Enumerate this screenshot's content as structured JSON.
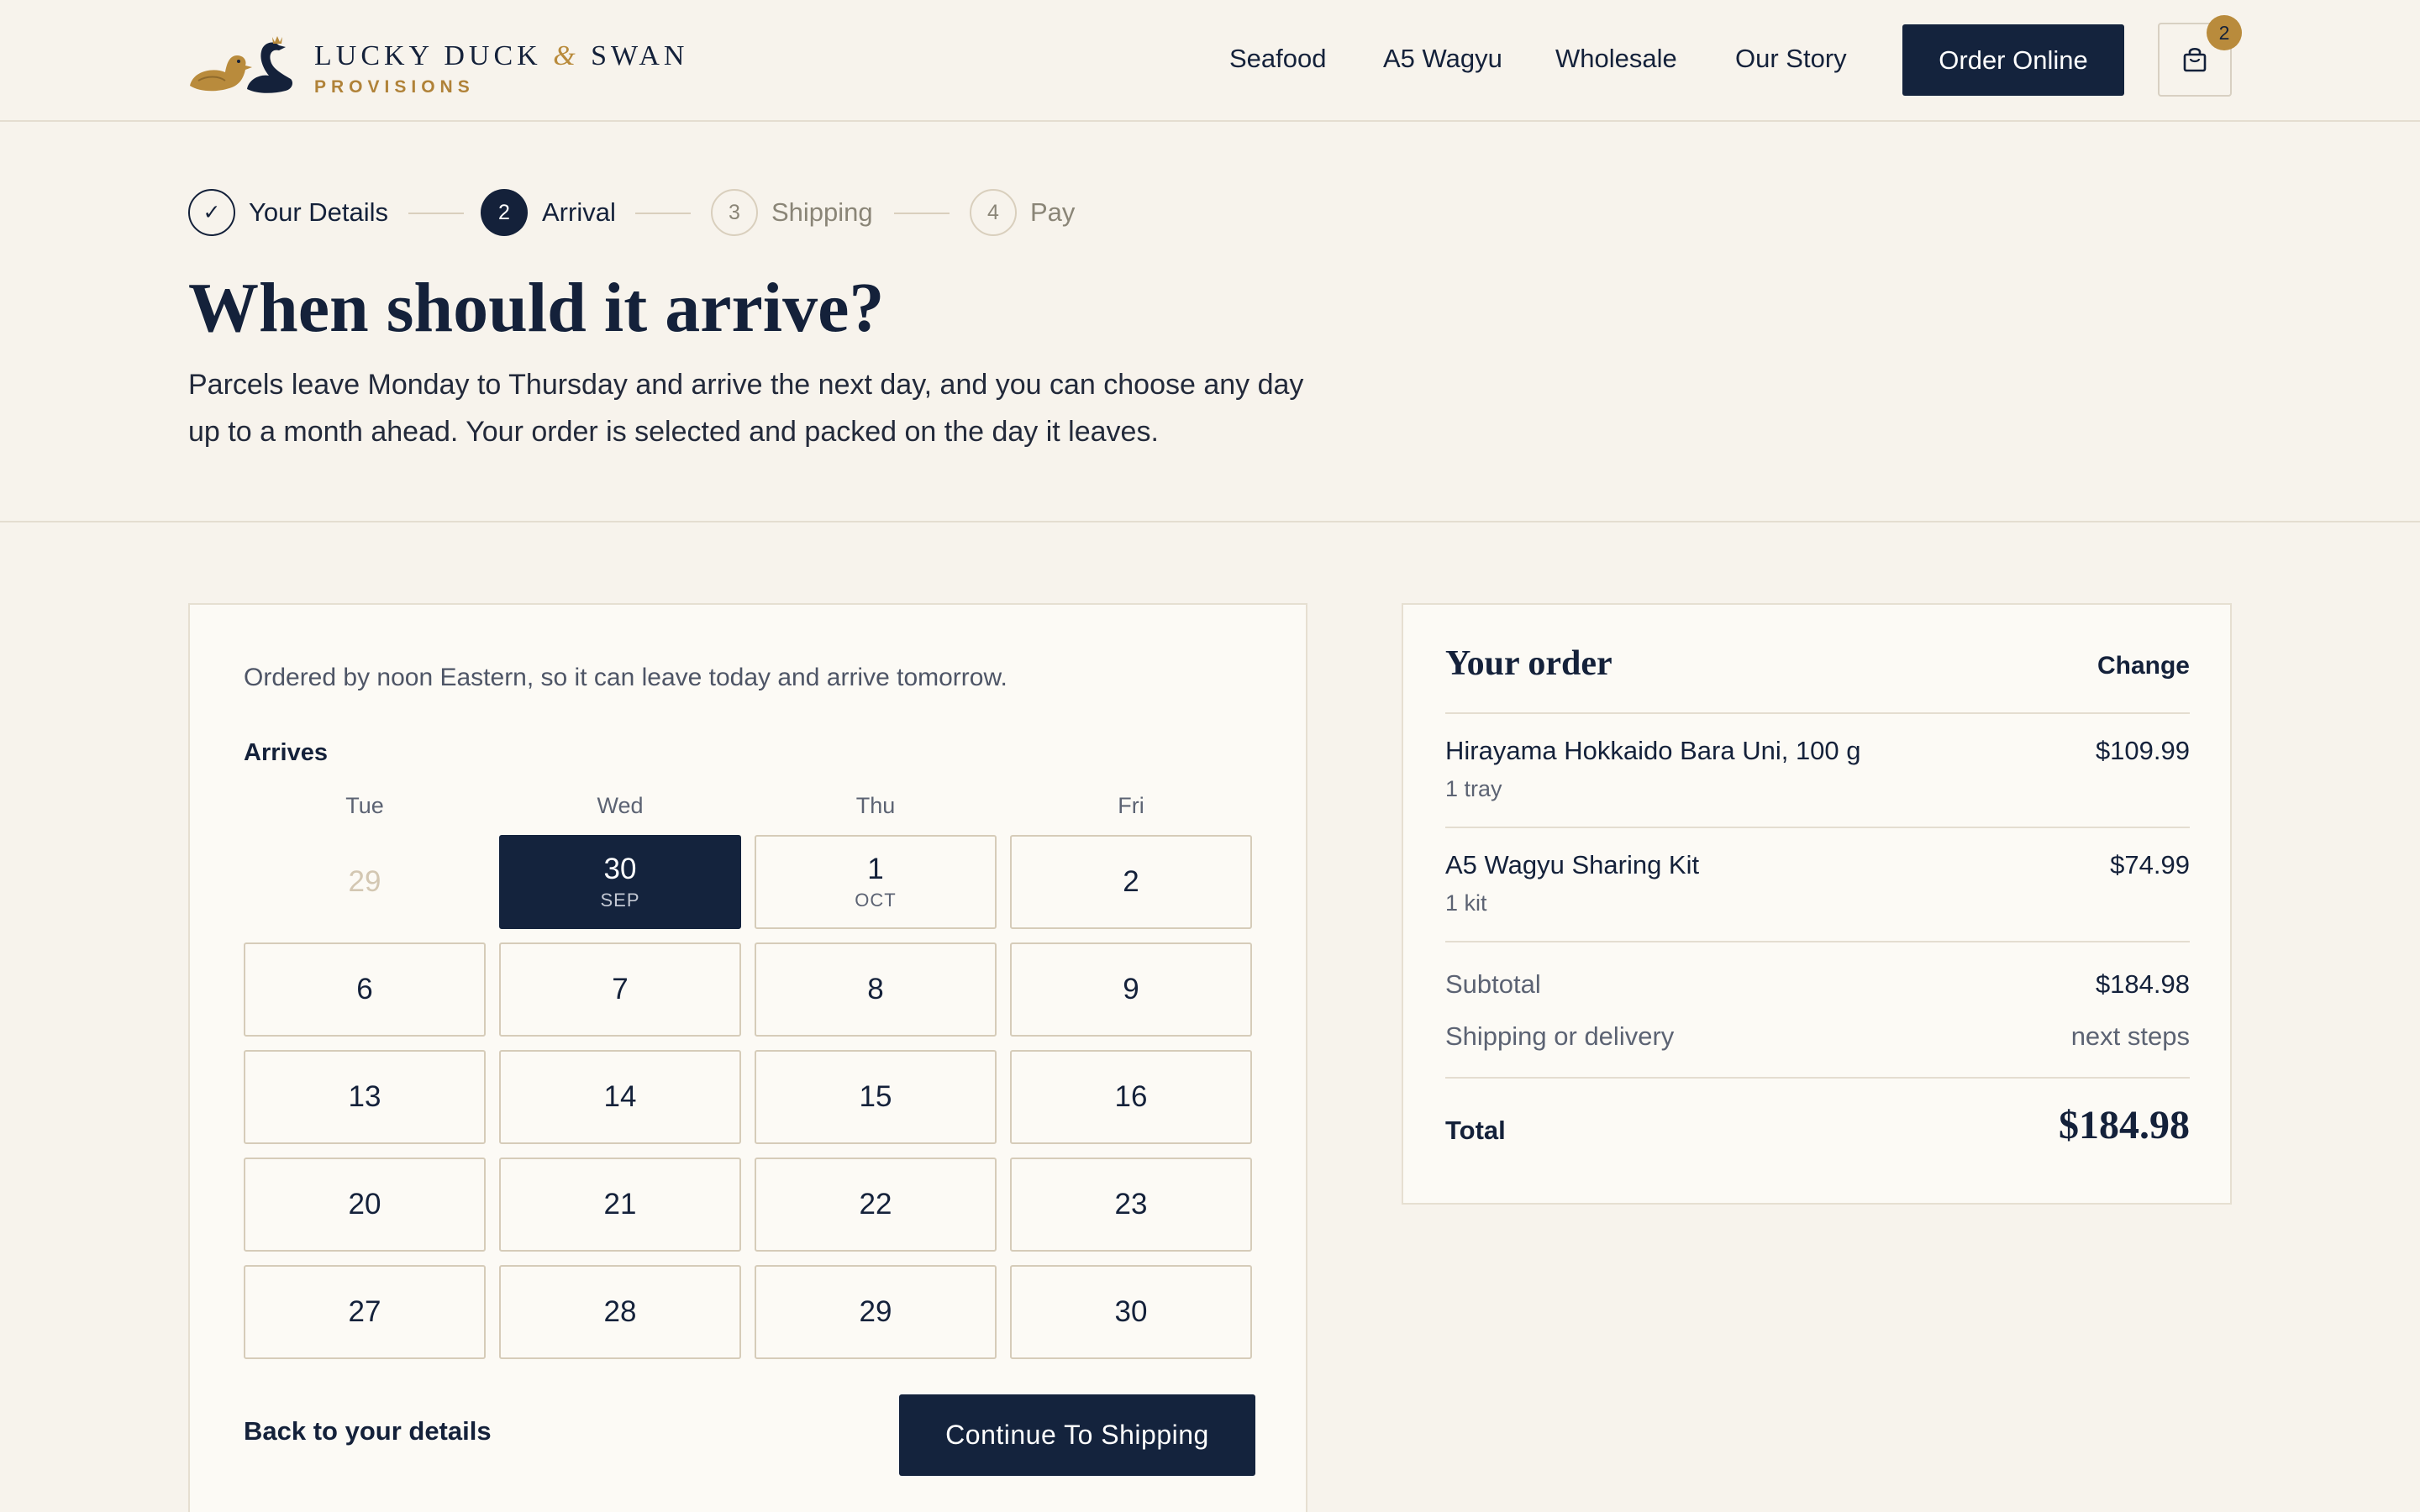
{
  "brand": {
    "name_part1": "LUCKY DUCK",
    "name_amp": "&",
    "name_part2": "SWAN",
    "tagline": "PROVISIONS"
  },
  "nav": {
    "links": [
      "Seafood",
      "A5 Wagyu",
      "Wholesale",
      "Our Story"
    ],
    "order_button": "Order Online",
    "cart_count": "2",
    "cart_icon": "shopping-bag-icon"
  },
  "steps": [
    {
      "marker": "✓",
      "label": "Your Details",
      "state": "done"
    },
    {
      "marker": "2",
      "label": "Arrival",
      "state": "active"
    },
    {
      "marker": "3",
      "label": "Shipping",
      "state": "future"
    },
    {
      "marker": "4",
      "label": "Pay",
      "state": "future"
    }
  ],
  "page": {
    "title": "When should it arrive?",
    "intro": "Parcels leave Monday to Thursday and arrive the next day, and you can choose any day up to a month ahead. Your order is selected and packed on the day it leaves."
  },
  "calendar": {
    "note": "Ordered by noon Eastern, so it can leave today and arrive tomorrow.",
    "label": "Arrives",
    "weekdays": [
      "Tue",
      "Wed",
      "Thu",
      "Fri"
    ],
    "weeks": [
      [
        {
          "day": "29",
          "state": "disabled"
        },
        {
          "day": "30",
          "month": "SEP",
          "state": "selected"
        },
        {
          "day": "1",
          "month": "OCT"
        },
        {
          "day": "2"
        }
      ],
      [
        {
          "day": "6"
        },
        {
          "day": "7"
        },
        {
          "day": "8"
        },
        {
          "day": "9"
        }
      ],
      [
        {
          "day": "13"
        },
        {
          "day": "14"
        },
        {
          "day": "15"
        },
        {
          "day": "16"
        }
      ],
      [
        {
          "day": "20"
        },
        {
          "day": "21"
        },
        {
          "day": "22"
        },
        {
          "day": "23"
        }
      ],
      [
        {
          "day": "27"
        },
        {
          "day": "28"
        },
        {
          "day": "29"
        },
        {
          "day": "30"
        }
      ]
    ],
    "back_label": "Back to your details",
    "continue_label": "Continue To Shipping"
  },
  "order": {
    "title": "Your order",
    "change_label": "Change",
    "items": [
      {
        "name": "Hirayama Hokkaido Bara Uni, 100 g",
        "qty": "1 tray",
        "price": "$109.99"
      },
      {
        "name": "A5 Wagyu Sharing Kit",
        "qty": "1 kit",
        "price": "$74.99"
      }
    ],
    "subtotal_label": "Subtotal",
    "subtotal_value": "$184.98",
    "shipping_label": "Shipping or delivery",
    "shipping_value": "next steps",
    "total_label": "Total",
    "total_value": "$184.98"
  },
  "colors": {
    "background": "#f7f3ec",
    "navy": "#14233d",
    "gold": "#b98b3c"
  }
}
